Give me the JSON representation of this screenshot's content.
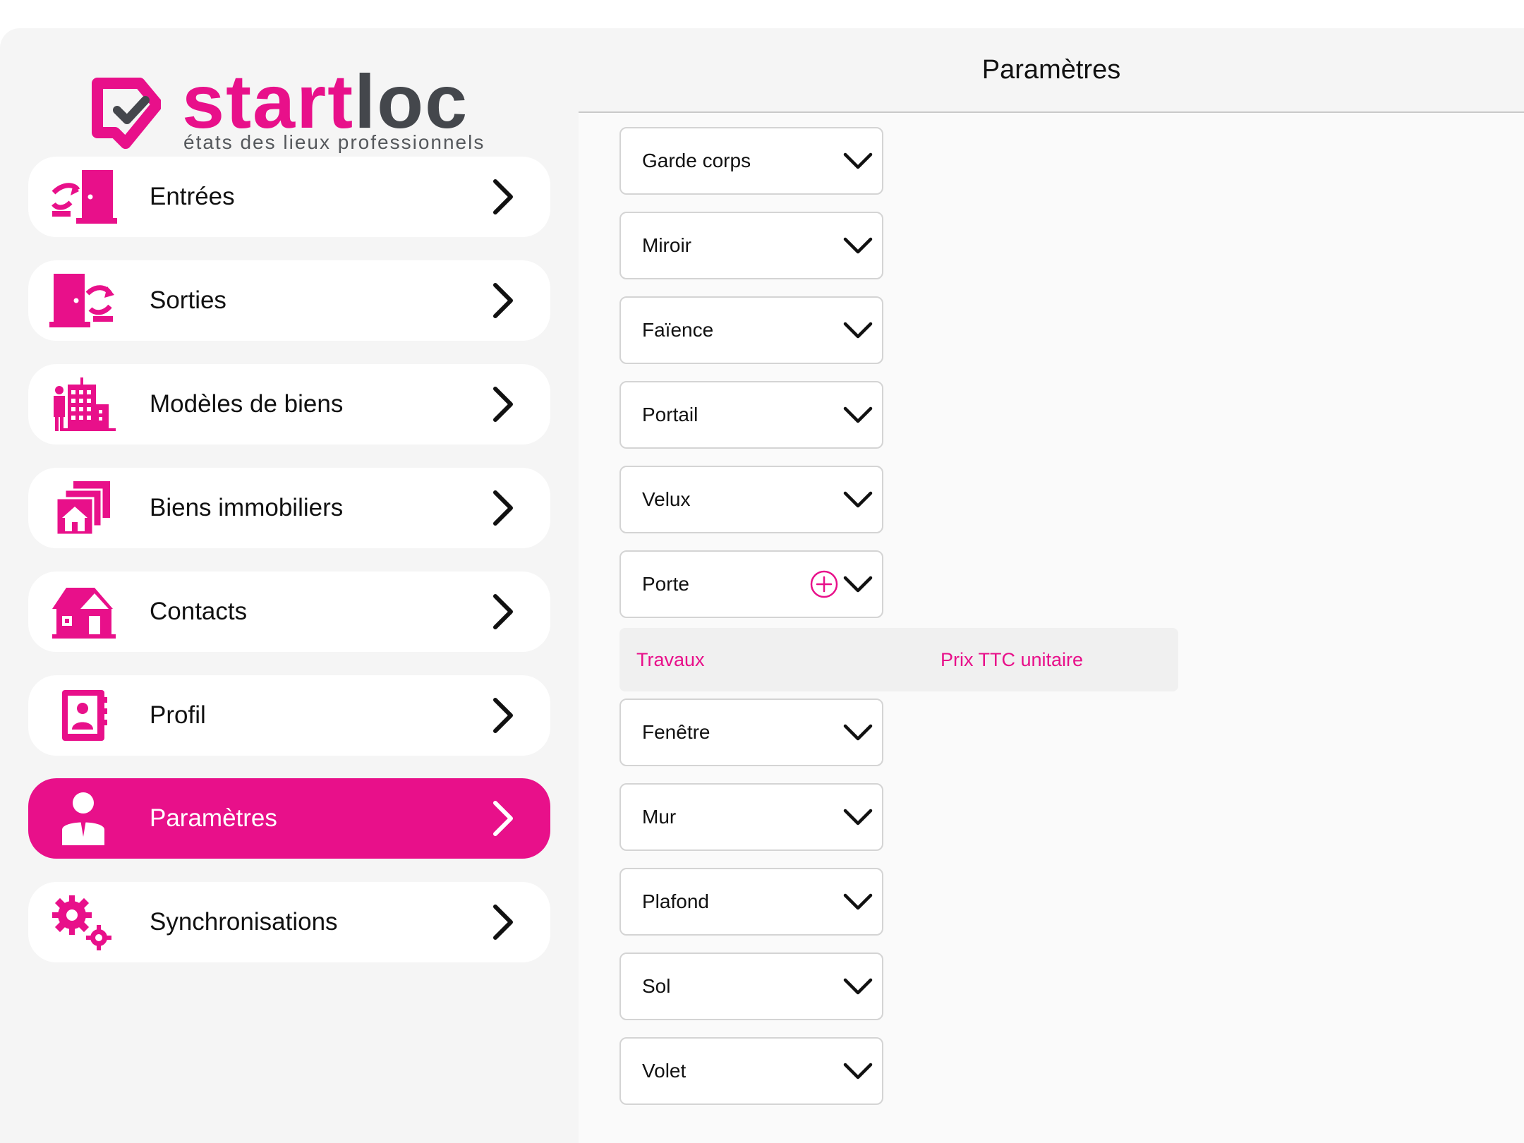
{
  "brand": {
    "name_part1": "start",
    "name_part2": "loc",
    "tagline": "états des lieux professionnels",
    "accent_color": "#e8108a",
    "dark_color": "#44474c"
  },
  "sidebar": {
    "items": [
      {
        "label": "Entrées",
        "icon": "door-enter-icon",
        "active": false
      },
      {
        "label": "Sorties",
        "icon": "door-exit-icon",
        "active": false
      },
      {
        "label": "Modèles de biens",
        "icon": "building-person-icon",
        "active": false
      },
      {
        "label": "Biens immobiliers",
        "icon": "house-stack-icon",
        "active": false
      },
      {
        "label": "Contacts",
        "icon": "house-icon",
        "active": false
      },
      {
        "label": "Profil",
        "icon": "contact-book-icon",
        "active": false
      },
      {
        "label": "Paramètres",
        "icon": "user-icon",
        "active": true
      },
      {
        "label": "Synchronisations",
        "icon": "gears-icon",
        "active": false
      }
    ]
  },
  "main": {
    "title": "Paramètres",
    "dropdowns_top": [
      {
        "label": "Garde corps"
      },
      {
        "label": "Miroir"
      },
      {
        "label": "Faïence"
      },
      {
        "label": "Portail"
      },
      {
        "label": "Velux"
      },
      {
        "label": "Porte",
        "has_add": true
      }
    ],
    "subheader": {
      "col1": "Travaux",
      "col2": "Prix TTC unitaire"
    },
    "dropdowns_bottom": [
      {
        "label": "Fenêtre"
      },
      {
        "label": "Mur"
      },
      {
        "label": "Plafond"
      },
      {
        "label": "Sol"
      },
      {
        "label": "Volet"
      }
    ]
  }
}
